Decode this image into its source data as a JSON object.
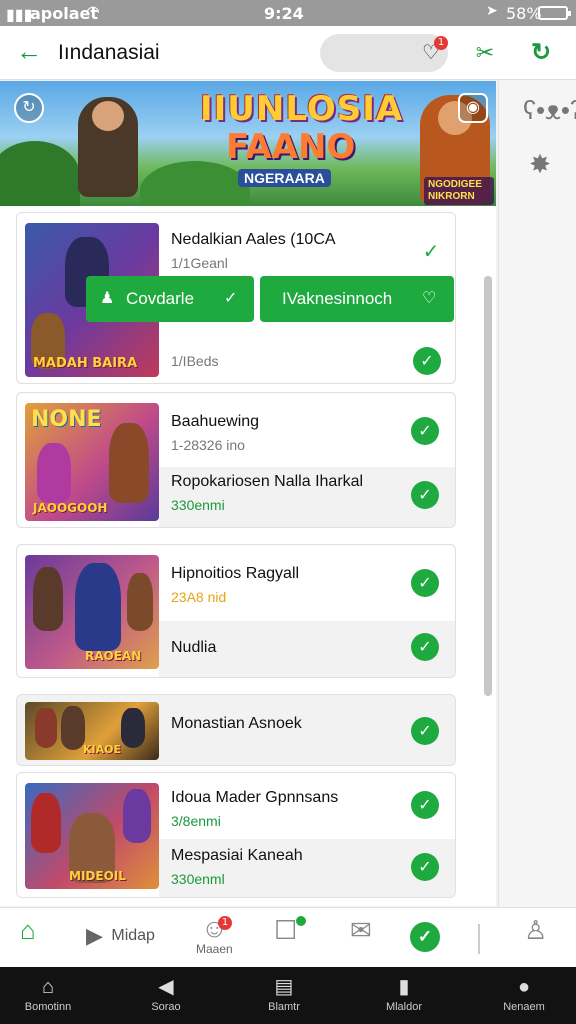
{
  "status_bar": {
    "carrier": "apolaet",
    "time": "9:24",
    "battery": "58%"
  },
  "header": {
    "title": "Iındanasiai",
    "heart_badge": "1"
  },
  "banner": {
    "title_line1": "IIUNLOSIA",
    "title_line2": "FAANO",
    "subtitle": "NGERAARA",
    "corner_text": "NGODIGEE NIKRORN"
  },
  "cards": [
    {
      "title": "Nedalkian Aales (10CA",
      "subtitle": "1/1Geanl",
      "thumb_label": "MADAH BAIRA",
      "buttons": [
        {
          "label": "Covdarle"
        },
        {
          "label": "IVaknesinnoch"
        }
      ],
      "footer": "1/IBeds"
    },
    {
      "title": "Baahuewing",
      "subtitle": "1-28326 ino",
      "thumb_label": "JAOOGOOH",
      "thumb_title": "NONE",
      "sub_title": "Ropokariosen Nalla Iharkal",
      "sub_subtitle": "330enmi"
    },
    {
      "title": "Hipnoitios Ragyall",
      "subtitle": "23A8 nid",
      "thumb_label": "RAOEAN",
      "sub_title": "Nudlia"
    },
    {
      "title": "Monastian Asnoek",
      "thumb_label": "KIAOE"
    },
    {
      "title": "Idoua Mader Gpnnsans",
      "subtitle": "3/8enmi",
      "thumb_label": "MIDEOIL",
      "sub_title": "Mespasiai Kaneah",
      "sub_subtitle": "330enml"
    }
  ],
  "bottom_bar": {
    "play_label": "Midap",
    "messages_label": "Maaen",
    "messages_badge": "1"
  },
  "system_nav": [
    {
      "label": "Bomotinn",
      "icon": "home-icon"
    },
    {
      "label": "Sorao",
      "icon": "cast-icon"
    },
    {
      "label": "Blamtr",
      "icon": "document-icon"
    },
    {
      "label": "Mlaldor",
      "icon": "bookmark-icon"
    },
    {
      "label": "Nenaem",
      "icon": "person-icon"
    }
  ],
  "colors": {
    "accent": "#1faa3f",
    "badge": "#e53935"
  }
}
